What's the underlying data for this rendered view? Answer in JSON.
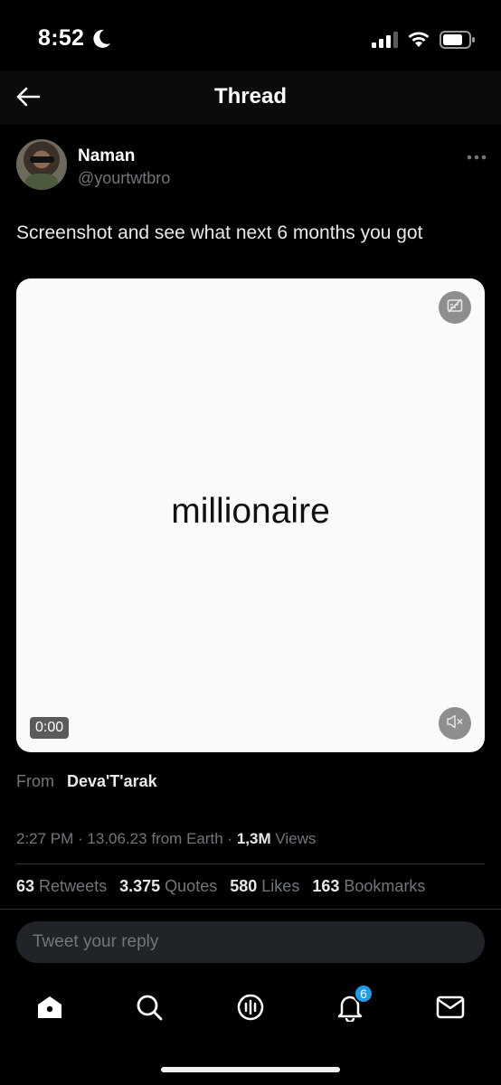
{
  "status_bar": {
    "time": "8:52",
    "icons": [
      "moon-icon",
      "signal-icon",
      "wifi-icon",
      "battery-icon"
    ]
  },
  "nav": {
    "title": "Thread",
    "back_icon": "arrow-left-icon"
  },
  "author": {
    "name": "Naman",
    "handle": "@yourtwtbro"
  },
  "tweet": {
    "text": "Screenshot and see what next 6 months you got",
    "media": {
      "caption": "millionaire",
      "duration": "0:00"
    },
    "source_label": "From",
    "source_name": "Deva'T'arak",
    "time": "2:27 PM",
    "date": "13.06.23",
    "location": "from Earth",
    "views_count": "1,3M",
    "views_label": "Views"
  },
  "stats": [
    {
      "num": "63",
      "label": "Retweets"
    },
    {
      "num": "3.375",
      "label": "Quotes"
    },
    {
      "num": "580",
      "label": "Likes"
    },
    {
      "num": "163",
      "label": "Bookmarks"
    }
  ],
  "reply": {
    "placeholder": "Tweet your reply"
  },
  "tab_bar": {
    "tabs": [
      "home-icon",
      "search-icon",
      "spaces-icon",
      "bell-icon",
      "mail-icon"
    ],
    "notification_count": "6"
  },
  "colors": {
    "background": "#000000",
    "text": "#e7e9ea",
    "secondary": "#71767b",
    "accent": "#1d9bf0"
  }
}
